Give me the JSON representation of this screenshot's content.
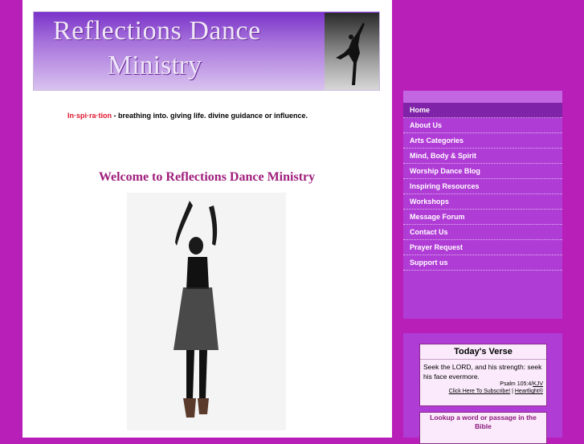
{
  "banner": {
    "line1": "Reflections Dance",
    "line2": "Ministry"
  },
  "tagline": {
    "word": "In·spi·ra·tion",
    "definition": " - breathing into. giving life. divine guidance or influence."
  },
  "welcome": "Welcome to Reflections Dance Ministry",
  "nav": {
    "items": [
      {
        "label": "Home"
      },
      {
        "label": "About Us"
      },
      {
        "label": "Arts Categories"
      },
      {
        "label": "Mind, Body & Spirit"
      },
      {
        "label": "Worship Dance Blog"
      },
      {
        "label": "Inspiring Resources"
      },
      {
        "label": "Workshops"
      },
      {
        "label": "Message Forum"
      },
      {
        "label": "Contact Us"
      },
      {
        "label": "Prayer Request"
      },
      {
        "label": "Support us"
      }
    ]
  },
  "verse": {
    "title": "Today's Verse",
    "text": "Seek the LORD, and his strength: seek his face evermore.",
    "reference": "Psalm 105:4/",
    "version": "KJV",
    "subscribe": "Click Here To Subscribe!",
    "separator": " | ",
    "heartlight": "Heartlight®"
  },
  "lookup": {
    "title": "Lookup a word or passage in the Bible"
  },
  "colors": {
    "background": "#b81fb8",
    "nav_panel": "#b03cd6",
    "nav_active": "#7f23a8",
    "tagline_word": "#e0142c",
    "welcome_text": "#a01e7c"
  }
}
